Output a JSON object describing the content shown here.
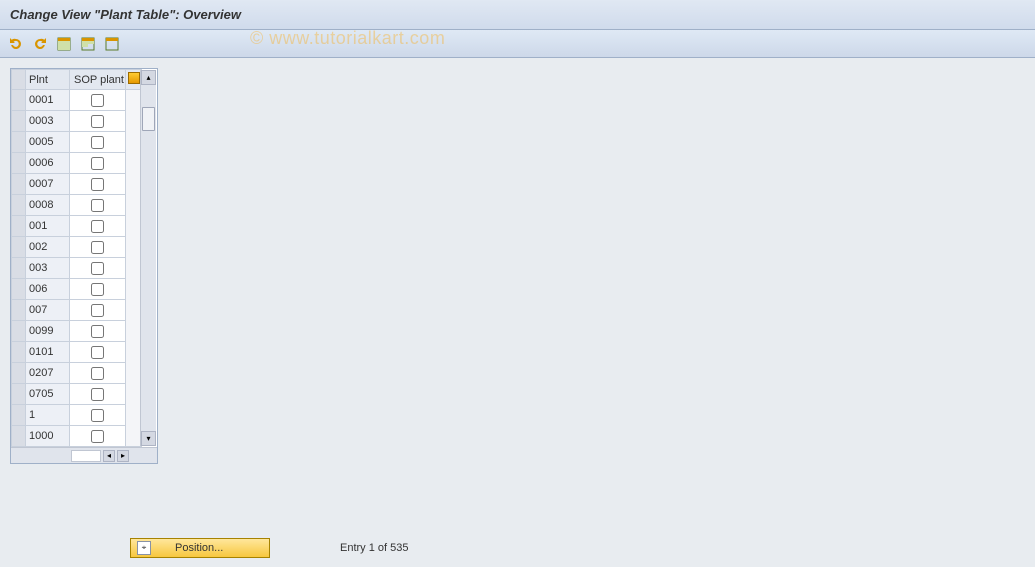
{
  "title": "Change View \"Plant Table\": Overview",
  "watermark": "© www.tutorialkart.com",
  "toolbar": {
    "undo_icon": "undo-icon",
    "redo_icon": "redo-icon",
    "select_all_icon": "select-all-icon",
    "select_block_icon": "select-block-icon",
    "deselect_all_icon": "deselect-all-icon"
  },
  "table": {
    "headers": {
      "select": "",
      "plnt": "Plnt",
      "sop": "SOP plant",
      "config": ""
    },
    "rows": [
      {
        "plnt": "0001",
        "sop": false
      },
      {
        "plnt": "0003",
        "sop": false
      },
      {
        "plnt": "0005",
        "sop": false
      },
      {
        "plnt": "0006",
        "sop": false
      },
      {
        "plnt": "0007",
        "sop": false
      },
      {
        "plnt": "0008",
        "sop": false
      },
      {
        "plnt": "001",
        "sop": false
      },
      {
        "plnt": "002",
        "sop": false
      },
      {
        "plnt": "003",
        "sop": false
      },
      {
        "plnt": "006",
        "sop": false
      },
      {
        "plnt": "007",
        "sop": false
      },
      {
        "plnt": "0099",
        "sop": false
      },
      {
        "plnt": "0101",
        "sop": false
      },
      {
        "plnt": "0207",
        "sop": false
      },
      {
        "plnt": "0705",
        "sop": false
      },
      {
        "plnt": "1",
        "sop": false
      },
      {
        "plnt": "1000",
        "sop": false
      }
    ]
  },
  "footer": {
    "position_label": "Position...",
    "entry_text": "Entry 1 of 535"
  }
}
